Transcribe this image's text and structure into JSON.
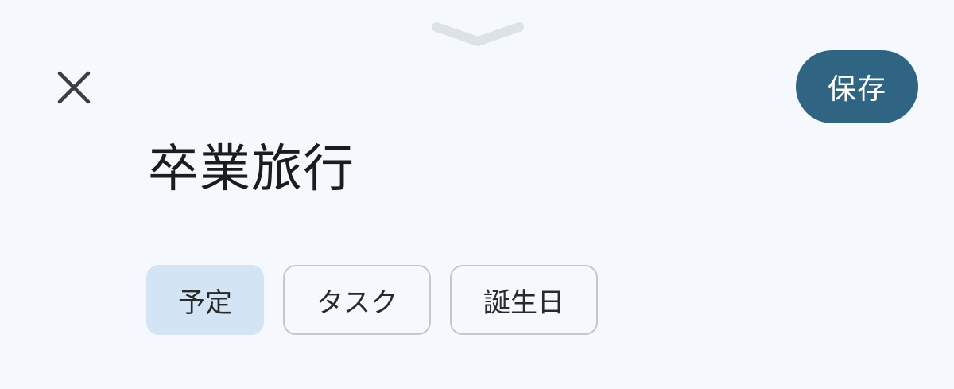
{
  "sheet": {
    "drag_handle_icon": "chevron-down-icon"
  },
  "header": {
    "close_icon": "close-icon",
    "save_label": "保存"
  },
  "event": {
    "title": "卒業旅行"
  },
  "type_chips": [
    {
      "label": "予定",
      "selected": true
    },
    {
      "label": "タスク",
      "selected": false
    },
    {
      "label": "誕生日",
      "selected": false
    }
  ],
  "colors": {
    "background": "#f5f9fe",
    "save_button": "#2f6483",
    "selected_chip": "#d3e4f4",
    "chip_border": "#c4c7cc"
  }
}
